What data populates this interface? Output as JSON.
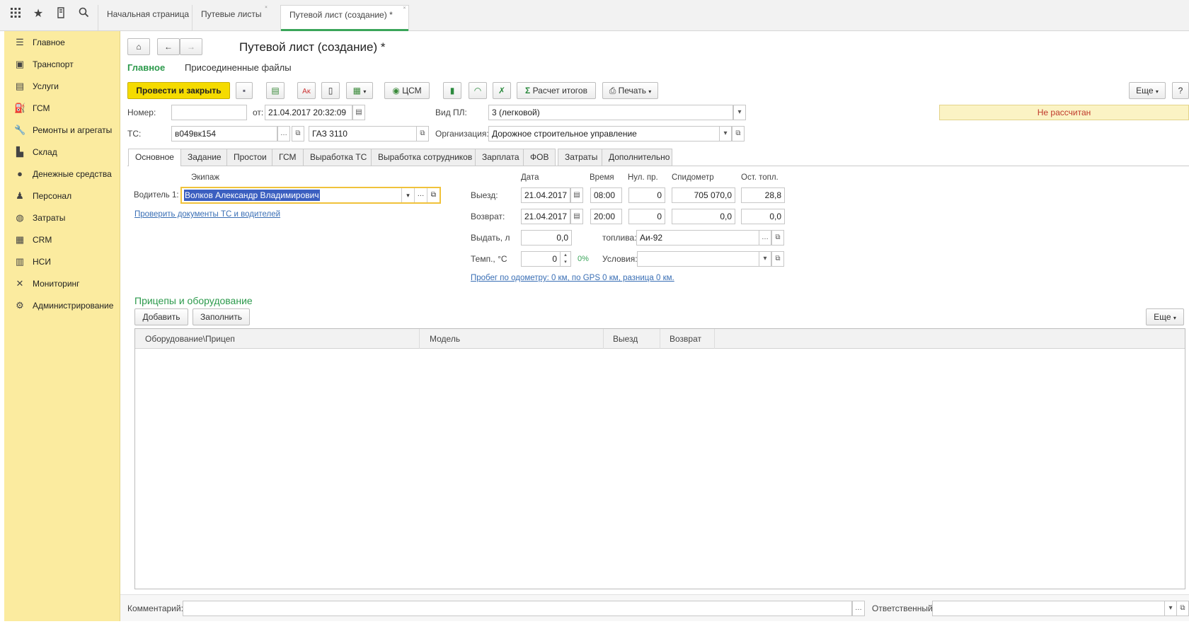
{
  "topbar": {
    "icons": [
      "apps-grid-icon",
      "star-icon",
      "history-icon",
      "search-icon"
    ],
    "tabs": [
      {
        "label": "Начальная страница",
        "active": false
      },
      {
        "label": "Путевые листы",
        "active": false
      },
      {
        "label": "Путевой лист (создание) *",
        "active": true
      }
    ]
  },
  "sidebar": {
    "items": [
      {
        "label": "Главное",
        "icon": "menu-icon"
      },
      {
        "label": "Транспорт",
        "icon": "bus-icon"
      },
      {
        "label": "Услуги",
        "icon": "services-icon"
      },
      {
        "label": "ГСМ",
        "icon": "fuel-icon"
      },
      {
        "label": "Ремонты и агрегаты",
        "icon": "wrench-icon"
      },
      {
        "label": "Склад",
        "icon": "warehouse-icon"
      },
      {
        "label": "Денежные средства",
        "icon": "money-icon"
      },
      {
        "label": "Персонал",
        "icon": "person-icon"
      },
      {
        "label": "Затраты",
        "icon": "expenses-icon"
      },
      {
        "label": "CRM",
        "icon": "crm-icon"
      },
      {
        "label": "НСИ",
        "icon": "reference-icon"
      },
      {
        "label": "Мониторинг",
        "icon": "monitoring-icon"
      },
      {
        "label": "Администрирование",
        "icon": "gear-icon"
      }
    ]
  },
  "header": {
    "title": "Путевой лист (создание) *",
    "subnav": {
      "main": "Главное",
      "files": "Присоединенные файлы"
    }
  },
  "toolbar": {
    "post_close": "Провести и закрыть",
    "csm": "ЦСМ",
    "totals": "Расчет итогов",
    "print": "Печать",
    "more": "Еще",
    "help": "?"
  },
  "form": {
    "number_label": "Номер:",
    "number_value": "",
    "from_label": "от:",
    "from_value": "21.04.2017 20:32:09",
    "kind_label": "Вид ПЛ:",
    "kind_value": "3 (легковой)",
    "status": "Не рассчитан",
    "ts_label": "ТС:",
    "ts_value": "в049вк154",
    "ts_model": "ГАЗ 3110",
    "org_label": "Организация:",
    "org_value": "Дорожное строительное управление"
  },
  "form_tabs": [
    "Основное",
    "Задание",
    "Простои",
    "ГСМ",
    "Выработка ТС",
    "Выработка сотрудников",
    "Зарплата",
    "ФОВ",
    "Затраты",
    "Дополнительно"
  ],
  "crew": {
    "header": "Экипаж",
    "driver_label": "Водитель 1:",
    "driver_value": "Волков Александр Владимирович",
    "check_link": "Проверить документы ТС и водителей"
  },
  "trip": {
    "headers": {
      "date": "Дата",
      "time": "Время",
      "zero": "Нул. пр.",
      "speedo": "Спидометр",
      "fuel": "Ост. топл."
    },
    "depart": {
      "label": "Выезд:",
      "date": "21.04.2017",
      "time": "08:00",
      "zero": "0",
      "speedo": "705 070,0",
      "fuel": "28,8"
    },
    "return": {
      "label": "Возврат:",
      "date": "21.04.2017",
      "time": "20:00",
      "zero": "0",
      "speedo": "0,0",
      "fuel": "0,0"
    },
    "issue_label": "Выдать, л",
    "issue_value": "0,0",
    "fuel_type_label": "топлива:",
    "fuel_type_value": "Аи-92",
    "temp_label": "Темп., °С",
    "temp_value": "0",
    "temp_pct": "0%",
    "conditions_label": "Условия:",
    "conditions_value": "",
    "odometer_link": "Пробег по одометру: 0 км, по GPS 0 км, разница 0 км."
  },
  "trailers": {
    "title": "Прицепы и оборудование",
    "add": "Добавить",
    "fill": "Заполнить",
    "more": "Еще",
    "columns": [
      "Оборудование\\Прицеп",
      "Модель",
      "Выезд",
      "Возврат"
    ]
  },
  "footer": {
    "comment_label": "Комментарий:",
    "comment_value": "",
    "responsible_label": "Ответственный:",
    "responsible_value": ""
  }
}
